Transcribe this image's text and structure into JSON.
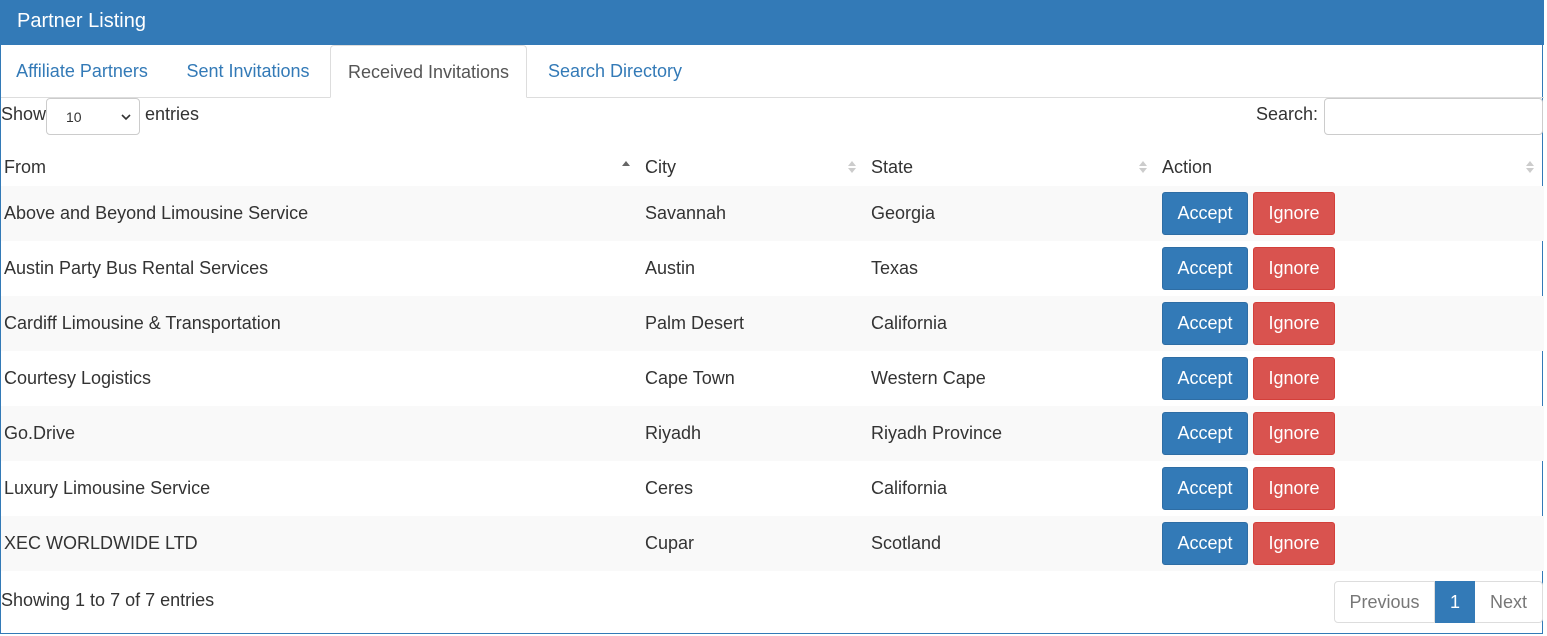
{
  "panel": {
    "title": "Partner Listing"
  },
  "tabs": [
    {
      "label": "Affiliate Partners"
    },
    {
      "label": "Sent Invitations"
    },
    {
      "label": "Received Invitations",
      "active": true
    },
    {
      "label": "Search Directory"
    }
  ],
  "length": {
    "show_label": "Show",
    "selected": "10",
    "entries_label": "entries"
  },
  "search": {
    "label": "Search:",
    "value": "",
    "placeholder": ""
  },
  "table": {
    "columns": [
      {
        "label": "From",
        "sort": "asc"
      },
      {
        "label": "City",
        "sort": "both"
      },
      {
        "label": "State",
        "sort": "both"
      },
      {
        "label": "Action",
        "sort": "both"
      }
    ],
    "rows": [
      {
        "from": "Above and Beyond Limousine Service",
        "city": "Savannah",
        "state": "Georgia"
      },
      {
        "from": "Austin Party Bus Rental Services",
        "city": "Austin",
        "state": "Texas"
      },
      {
        "from": "Cardiff Limousine & Transportation",
        "city": "Palm Desert",
        "state": "California"
      },
      {
        "from": "Courtesy Logistics",
        "city": "Cape Town",
        "state": "Western Cape"
      },
      {
        "from": "Go.Drive",
        "city": "Riyadh",
        "state": "Riyadh Province"
      },
      {
        "from": "Luxury Limousine Service",
        "city": "Ceres",
        "state": "California"
      },
      {
        "from": "XEC WORLDWIDE LTD",
        "city": "Cupar",
        "state": "Scotland"
      }
    ],
    "accept_label": "Accept",
    "ignore_label": "Ignore"
  },
  "footer": {
    "info": "Showing 1 to 7 of 7 entries",
    "previous": "Previous",
    "current_page": "1",
    "next": "Next"
  },
  "colors": {
    "primary": "#337ab7",
    "danger": "#d9534f",
    "stripe": "#f9f9f9"
  }
}
